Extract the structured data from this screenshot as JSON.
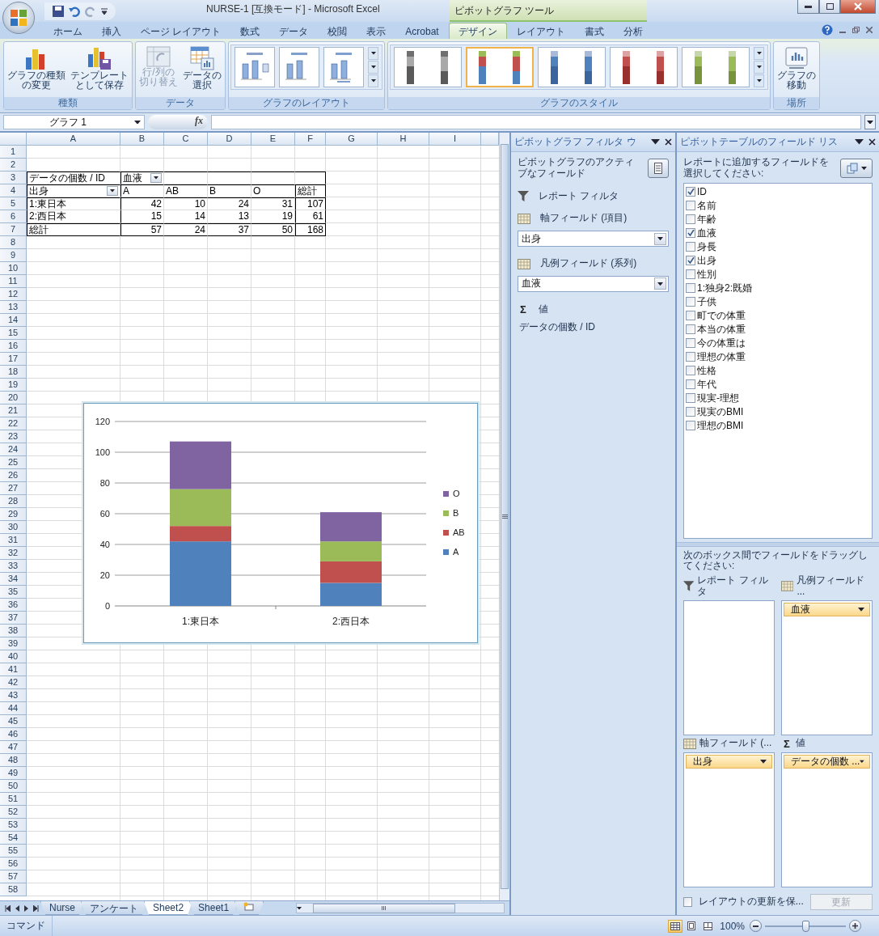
{
  "window": {
    "title": "NURSE-1  [互換モード] - Microsoft Excel",
    "context_label": "ピボットグラフ ツール"
  },
  "ribbon_tabs": [
    {
      "label": "ホーム",
      "selected": false
    },
    {
      "label": "挿入",
      "selected": false
    },
    {
      "label": "ページ レイアウト",
      "selected": false
    },
    {
      "label": "数式",
      "selected": false
    },
    {
      "label": "データ",
      "selected": false
    },
    {
      "label": "校閲",
      "selected": false
    },
    {
      "label": "表示",
      "selected": false
    },
    {
      "label": "Acrobat",
      "selected": false
    },
    {
      "label": "デザイン",
      "selected": true
    },
    {
      "label": "レイアウト",
      "selected": false
    },
    {
      "label": "書式",
      "selected": false
    },
    {
      "label": "分析",
      "selected": false
    }
  ],
  "ribbon_groups": [
    {
      "kind": "buttons",
      "label": "種類",
      "buttons": [
        {
          "lines": [
            "グラフの種類",
            "の変更"
          ],
          "disabled": false
        },
        {
          "lines": [
            "テンプレート",
            "として保存"
          ],
          "disabled": false
        }
      ]
    },
    {
      "kind": "buttons",
      "label": "データ",
      "buttons": [
        {
          "lines": [
            "行/列の",
            "切り替え"
          ],
          "disabled": true
        },
        {
          "lines": [
            "データの",
            "選択"
          ],
          "disabled": false
        }
      ]
    },
    {
      "kind": "layouts",
      "label": "グラフのレイアウト"
    },
    {
      "kind": "styles",
      "label": "グラフのスタイル",
      "styles": [
        {
          "selected": false
        },
        {
          "selected": true
        },
        {
          "selected": false
        },
        {
          "selected": false
        },
        {
          "selected": false
        }
      ]
    },
    {
      "kind": "buttons",
      "label": "場所",
      "buttons": [
        {
          "lines": [
            "グラフの",
            "移動"
          ],
          "disabled": false
        }
      ]
    }
  ],
  "formula_bar": {
    "name_box": "グラフ 1",
    "function_label": "fx"
  },
  "sheet": {
    "columns": [
      "A",
      "B",
      "C",
      "D",
      "E",
      "F",
      "G",
      "H",
      "I"
    ],
    "rows": [
      {
        "label": "1"
      },
      {
        "label": "2"
      },
      {
        "label": "3",
        "cells": [
          {
            "text": "データの個数 / ID",
            "kind": "label",
            "filter_button": false
          },
          {
            "text": "血液",
            "kind": "label",
            "filter_button": true
          },
          null,
          null,
          null,
          null
        ]
      },
      {
        "label": "4",
        "cells": [
          {
            "text": "出身",
            "kind": "label",
            "filter_button": true
          },
          {
            "text": "A",
            "kind": "label",
            "filter_button": false
          },
          {
            "text": "AB",
            "kind": "label",
            "filter_button": false
          },
          {
            "text": "B",
            "kind": "label",
            "filter_button": false
          },
          {
            "text": "O",
            "kind": "label",
            "filter_button": false
          },
          {
            "text": "総計",
            "kind": "label",
            "filter_button": false
          }
        ]
      },
      {
        "label": "5",
        "cells": [
          {
            "text": "1:東日本",
            "kind": "label",
            "filter_button": false
          },
          {
            "text": "42",
            "kind": "number",
            "filter_button": false
          },
          {
            "text": "10",
            "kind": "number",
            "filter_button": false
          },
          {
            "text": "24",
            "kind": "number",
            "filter_button": false
          },
          {
            "text": "31",
            "kind": "number",
            "filter_button": false
          },
          {
            "text": "107",
            "kind": "number",
            "filter_button": false
          }
        ]
      },
      {
        "label": "6",
        "cells": [
          {
            "text": "2:西日本",
            "kind": "label",
            "filter_button": false
          },
          {
            "text": "15",
            "kind": "number",
            "filter_button": false
          },
          {
            "text": "14",
            "kind": "number",
            "filter_button": false
          },
          {
            "text": "13",
            "kind": "number",
            "filter_button": false
          },
          {
            "text": "19",
            "kind": "number",
            "filter_button": false
          },
          {
            "text": "61",
            "kind": "number",
            "filter_button": false
          }
        ]
      },
      {
        "label": "7",
        "cells": [
          {
            "text": "総計",
            "kind": "label",
            "filter_button": false
          },
          {
            "text": "57",
            "kind": "number",
            "filter_button": false
          },
          {
            "text": "24",
            "kind": "number",
            "filter_button": false
          },
          {
            "text": "37",
            "kind": "number",
            "filter_button": false
          },
          {
            "text": "50",
            "kind": "number",
            "filter_button": false
          },
          {
            "text": "168",
            "kind": "number",
            "filter_button": false
          }
        ]
      },
      {
        "label": "8"
      },
      {
        "label": "9"
      },
      {
        "label": "10"
      },
      {
        "label": "11"
      },
      {
        "label": "12"
      },
      {
        "label": "13"
      },
      {
        "label": "14"
      },
      {
        "label": "15"
      },
      {
        "label": "16"
      },
      {
        "label": "17"
      },
      {
        "label": "18"
      },
      {
        "label": "19"
      },
      {
        "label": "20"
      },
      {
        "label": "21"
      },
      {
        "label": "22"
      },
      {
        "label": "23"
      },
      {
        "label": "24"
      },
      {
        "label": "25"
      },
      {
        "label": "26"
      },
      {
        "label": "27"
      },
      {
        "label": "28"
      },
      {
        "label": "29"
      },
      {
        "label": "30"
      },
      {
        "label": "31"
      },
      {
        "label": "32"
      },
      {
        "label": "33"
      },
      {
        "label": "34"
      },
      {
        "label": "35"
      },
      {
        "label": "36"
      },
      {
        "label": "37"
      },
      {
        "label": "38"
      },
      {
        "label": "39"
      },
      {
        "label": "40"
      },
      {
        "label": "41"
      },
      {
        "label": "42"
      },
      {
        "label": "43"
      },
      {
        "label": "44"
      },
      {
        "label": "45"
      },
      {
        "label": "46"
      },
      {
        "label": "47"
      },
      {
        "label": "48"
      },
      {
        "label": "49"
      },
      {
        "label": "50"
      },
      {
        "label": "51"
      },
      {
        "label": "52"
      },
      {
        "label": "53"
      },
      {
        "label": "54"
      },
      {
        "label": "55"
      },
      {
        "label": "56"
      },
      {
        "label": "57"
      },
      {
        "label": "58"
      }
    ]
  },
  "chart": {
    "chart_data": {
      "type": "bar",
      "stacked": true,
      "orientation": "vertical",
      "categories": [
        "1:東日本",
        "2:西日本"
      ],
      "series": [
        {
          "name": "A",
          "color": "#4f81bd",
          "values": [
            42,
            15
          ]
        },
        {
          "name": "AB",
          "color": "#c0504d",
          "values": [
            10,
            14
          ]
        },
        {
          "name": "B",
          "color": "#9bbb59",
          "values": [
            24,
            13
          ]
        },
        {
          "name": "O",
          "color": "#8064a2",
          "values": [
            31,
            19
          ]
        }
      ],
      "ylim": [
        0,
        120
      ],
      "yticks": [
        0,
        20,
        40,
        60,
        80,
        100,
        120
      ],
      "grid": true,
      "legend": true
    }
  },
  "sheet_tabs": [
    {
      "label": "Nurse",
      "selected": false
    },
    {
      "label": "アンケート",
      "selected": false
    },
    {
      "label": "Sheet2",
      "selected": true
    },
    {
      "label": "Sheet1",
      "selected": false
    }
  ],
  "filter_pane": {
    "title": "ピボットグラフ フィルタ ウ",
    "heading": "ピボットグラフのアクティブなフィールド",
    "sections": [
      {
        "kind": "filter",
        "label": "レポート フィルタ"
      },
      {
        "kind": "axis",
        "label": "軸フィールド (項目)",
        "value": "出身"
      },
      {
        "kind": "legend",
        "label": "凡例フィールド (系列)",
        "value": "血液"
      },
      {
        "kind": "values",
        "symbol": "Σ",
        "label": "値",
        "text": "データの個数 / ID"
      }
    ]
  },
  "field_list": {
    "title": "ピボットテーブルのフィールド リス",
    "instruction": "レポートに追加するフィールドを選択してください:",
    "fields": [
      {
        "label": "ID",
        "checked": true
      },
      {
        "label": "名前",
        "checked": false
      },
      {
        "label": "年齢",
        "checked": false
      },
      {
        "label": "血液",
        "checked": true
      },
      {
        "label": "身長",
        "checked": false
      },
      {
        "label": "出身",
        "checked": true
      },
      {
        "label": "性別",
        "checked": false
      },
      {
        "label": "1:独身2:既婚",
        "checked": false
      },
      {
        "label": "子供",
        "checked": false
      },
      {
        "label": "町での体重",
        "checked": false
      },
      {
        "label": "本当の体重",
        "checked": false
      },
      {
        "label": "今の体重は",
        "checked": false
      },
      {
        "label": "理想の体重",
        "checked": false
      },
      {
        "label": "性格",
        "checked": false
      },
      {
        "label": "年代",
        "checked": false
      },
      {
        "label": "現実-理想",
        "checked": false
      },
      {
        "label": "現実のBMI",
        "checked": false
      },
      {
        "label": "理想のBMI",
        "checked": false
      }
    ],
    "drag_prompt": "次のボックス間でフィールドをドラッグしてください:",
    "areas": [
      {
        "kind": "filter",
        "label": "レポート フィルタ"
      },
      {
        "kind": "legend",
        "label": "凡例フィールド ...",
        "items": [
          "血液"
        ]
      },
      {
        "kind": "axis",
        "label": "軸フィールド (...",
        "items": [
          "出身"
        ]
      },
      {
        "kind": "values",
        "symbol": "Σ",
        "label": "値",
        "items": [
          "データの個数 ..."
        ]
      }
    ],
    "defer": {
      "label": "レイアウトの更新を保...",
      "checked": false
    },
    "update_button": {
      "label": "更新",
      "disabled": true
    }
  },
  "status_bar": {
    "mode": "コマンド",
    "views": [
      {
        "kind": "normal",
        "selected": true
      },
      {
        "kind": "page",
        "selected": false
      },
      {
        "kind": "break",
        "selected": false
      }
    ],
    "zoom": "100%",
    "zoom_slider": {
      "level": 0.5
    }
  }
}
